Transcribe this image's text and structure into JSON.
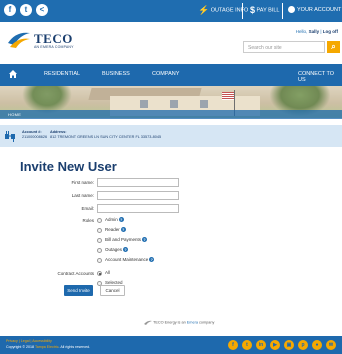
{
  "topbar": {
    "social": [
      {
        "name": "facebook-icon",
        "glyph": "f"
      },
      {
        "name": "twitter-icon",
        "glyph": "t"
      },
      {
        "name": "share-icon",
        "glyph": "<"
      }
    ],
    "outage_info": "OUTAGE INFO",
    "pay_bill": "PAY BILL",
    "your_account": "YOUR ACCOUNT",
    "outage_glyph": "⚡",
    "pay_glyph": "$",
    "caret": "▾"
  },
  "header": {
    "logo_text": "TECO",
    "logo_sub": "AN EMERA COMPANY",
    "greeting_prefix": "Hello, ",
    "user_name": "Sally",
    "greeting_sep": " | ",
    "logoff": "Log off",
    "search_placeholder": "Search our site",
    "search_glyph": "⌕"
  },
  "nav": {
    "items": [
      "RESIDENTIAL",
      "BUSINESS",
      "COMPANY"
    ],
    "connect": "CONNECT TO US"
  },
  "breadcrumb": "HOME",
  "account": {
    "acct_label": "Account #:",
    "acct_value": "211000008626",
    "addr_label": "Address:",
    "addr_value": "812 TREMONT GREENS LN SUN CITY CENTER FL 33573-8045"
  },
  "form": {
    "title": "Invite New User",
    "first_name": "First name:",
    "last_name": "Last name:",
    "email": "Email:",
    "roles_label": "Roles",
    "roles": [
      {
        "label": "Admin",
        "help": true
      },
      {
        "label": "Reader",
        "help": true
      },
      {
        "label": "Bill and Payments",
        "help": true
      },
      {
        "label": "Outages",
        "help": true
      },
      {
        "label": "Account Maintenance",
        "help": true
      }
    ],
    "help_glyph": "?",
    "contract_label": "Contract Accounts",
    "contract": [
      "All",
      "Selected"
    ],
    "contract_selected": "All",
    "send": "Send Invite",
    "cancel": "Cancel"
  },
  "emera": {
    "prefix": "TECO Energy is an ",
    "link": "Emera",
    "suffix": " company"
  },
  "footer": {
    "links": "Privacy | Legal | Accessibility",
    "copy_prefix": "Copyright © 2018 ",
    "copy_link": "Tampa Electric",
    "copy_suffix": ". All rights reserved.",
    "icons": [
      {
        "name": "facebook-icon",
        "glyph": "f"
      },
      {
        "name": "twitter-icon",
        "glyph": "t"
      },
      {
        "name": "linkedin-icon",
        "glyph": "in"
      },
      {
        "name": "youtube-icon",
        "glyph": "▶"
      },
      {
        "name": "instagram-icon",
        "glyph": "▣"
      },
      {
        "name": "pinterest-icon",
        "glyph": "p"
      },
      {
        "name": "flickr-icon",
        "glyph": "●"
      },
      {
        "name": "email-icon",
        "glyph": "✉"
      }
    ]
  },
  "colors": {
    "brand_blue": "#1e69ad",
    "navy": "#1a3e6e",
    "accent_orange": "#f5a800",
    "account_bar": "#d6e6f4"
  }
}
